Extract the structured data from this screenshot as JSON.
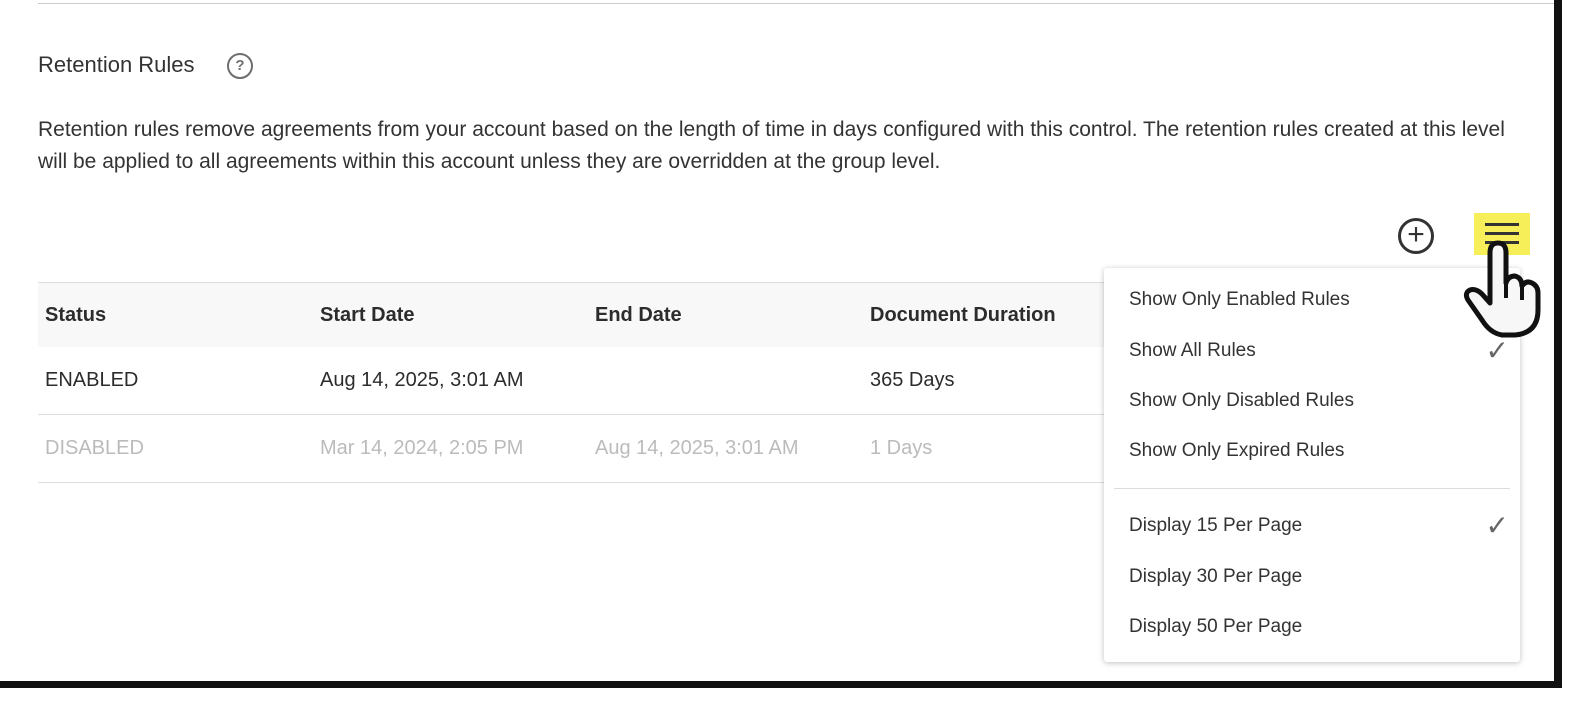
{
  "header": {
    "title": "Retention Rules",
    "help_icon": "question-circle-icon"
  },
  "description": "Retention rules remove agreements from your account based on the length of time in days configured with this control. The retention rules created at this level will be applied to all agreements within this account unless they are overridden at the group level.",
  "toolbar": {
    "add_icon": "plus-circle-icon",
    "menu_icon": "hamburger-menu-icon",
    "highlight_color": "#f6ef5a"
  },
  "table": {
    "columns": [
      "Status",
      "Start Date",
      "End Date",
      "Document Duration"
    ],
    "rows": [
      [
        "ENABLED",
        "Aug 14, 2025, 3:01 AM",
        "",
        "365 Days"
      ],
      [
        "DISABLED",
        "Mar 14, 2024, 2:05 PM",
        "Aug 14, 2025, 3:01 AM",
        "1 Days"
      ]
    ]
  },
  "menu": {
    "filter_items": [
      {
        "label": "Show Only Enabled Rules",
        "checked": false
      },
      {
        "label": "Show All Rules",
        "checked": true
      },
      {
        "label": "Show Only Disabled Rules",
        "checked": false
      },
      {
        "label": "Show Only Expired Rules",
        "checked": false
      }
    ],
    "page_items": [
      {
        "label": "Display 15 Per Page",
        "checked": true
      },
      {
        "label": "Display 30 Per Page",
        "checked": false
      },
      {
        "label": "Display 50 Per Page",
        "checked": false
      }
    ],
    "check": "✓"
  }
}
